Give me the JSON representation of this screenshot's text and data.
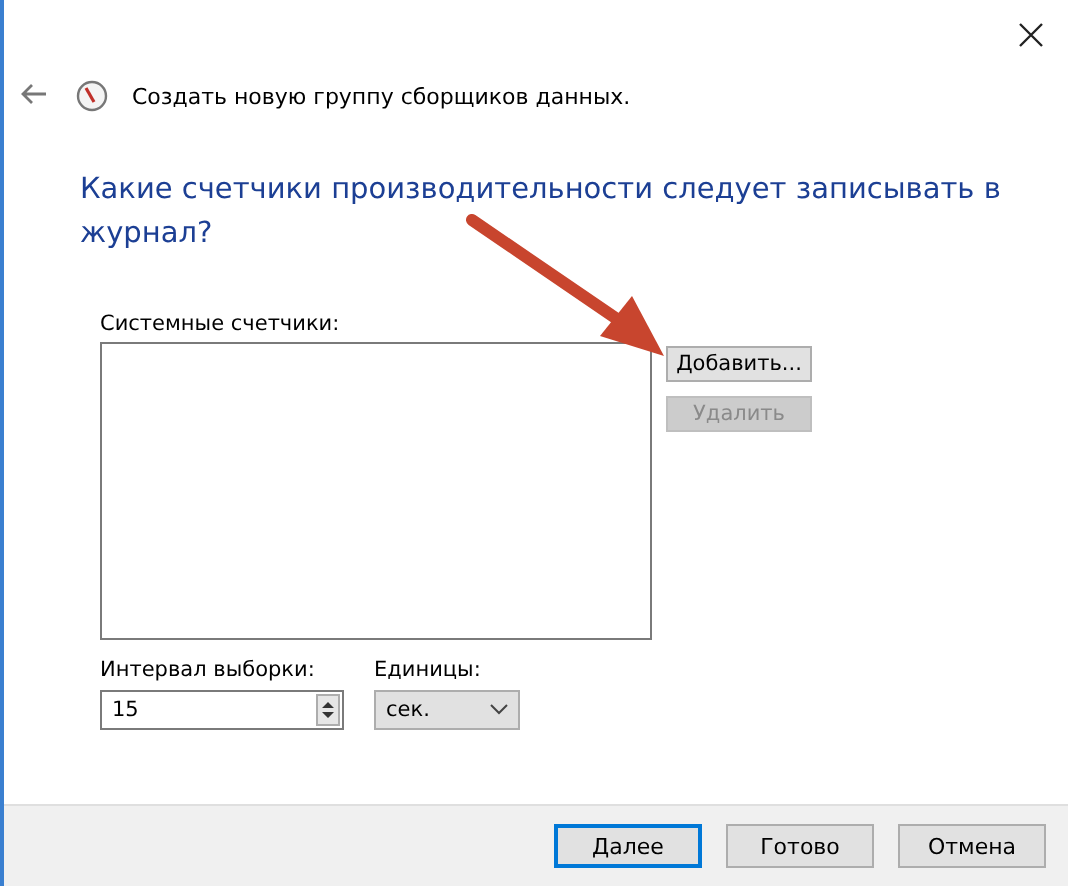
{
  "window": {
    "title": "Создать новую группу сборщиков данных."
  },
  "question": "Какие счетчики производительности следует записывать в журнал?",
  "counters": {
    "label": "Системные счетчики:",
    "buttons": [
      {
        "label": "Добавить...",
        "disabled": false
      },
      {
        "label": "Удалить",
        "disabled": true
      }
    ]
  },
  "interval": {
    "label": "Интервал выборки:",
    "value": "15"
  },
  "units": {
    "label": "Единицы:",
    "value": "сек."
  },
  "footer_buttons": [
    {
      "label": "Далее",
      "default": true
    },
    {
      "label": "Готово",
      "default": false
    },
    {
      "label": "Отмена",
      "default": false
    }
  ]
}
